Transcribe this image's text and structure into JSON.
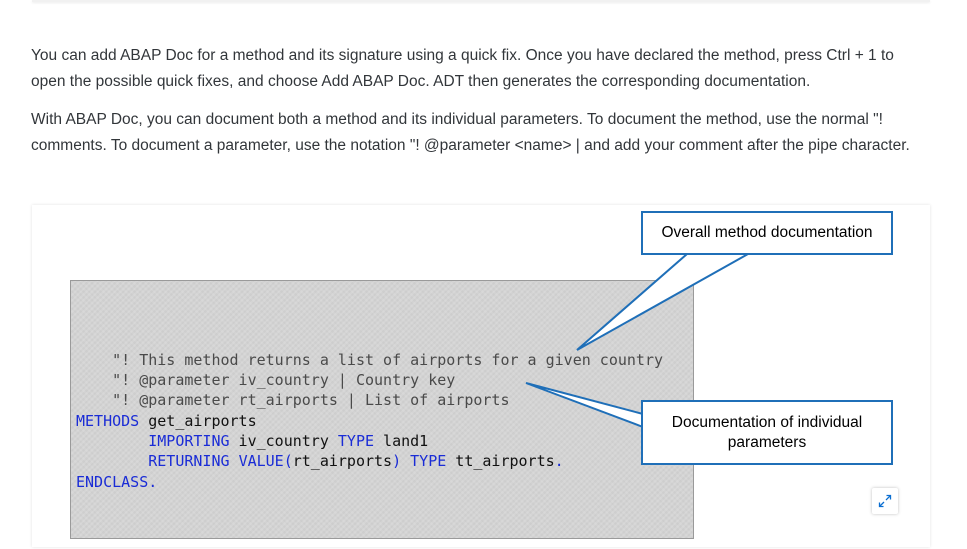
{
  "paragraphs": {
    "quick_fix": "You can add ABAP Doc for a method and its signature using a quick fix. Once you have declared the method, press Ctrl + 1 to open the possible quick fixes, and choose Add ABAP Doc. ADT then generates the corresponding documentation.",
    "documenting": "With ABAP Doc, you can document both a method and its individual parameters. To document the method, use the normal \"! comments. To document a parameter, use the notation \"! @parameter <name> | and add your comment after the pipe character."
  },
  "figure": {
    "code": {
      "line1": "    \"! This method returns a list of airports for a given country",
      "line2": "    \"! @parameter iv_country | Country key",
      "line3": "    \"! @parameter rt_airports | List of airports",
      "methods_kw": "METHODS",
      "method_name": " get_airports",
      "indent": "        ",
      "importing_kw": "IMPORTING",
      "iv_country": " iv_country ",
      "type_kw": "TYPE",
      "land1": " land1",
      "returning_kw": "RETURNING",
      "value_kw": "VALUE(",
      "rt_airports": "rt_airports",
      "close_paren": ")",
      "tt_airports": " tt_airports",
      "period": ".",
      "endclass": "ENDCLASS."
    },
    "callouts": {
      "method_doc": "Overall method documentation",
      "param_doc_line1": "Documentation of individual",
      "param_doc_line2": "parameters"
    },
    "colors": {
      "callout_border": "#1f6fb8",
      "keyword": "#1a2cd6",
      "comment": "#4a4a4a"
    },
    "expand_icon": "expand-diagonal-arrows-icon"
  }
}
